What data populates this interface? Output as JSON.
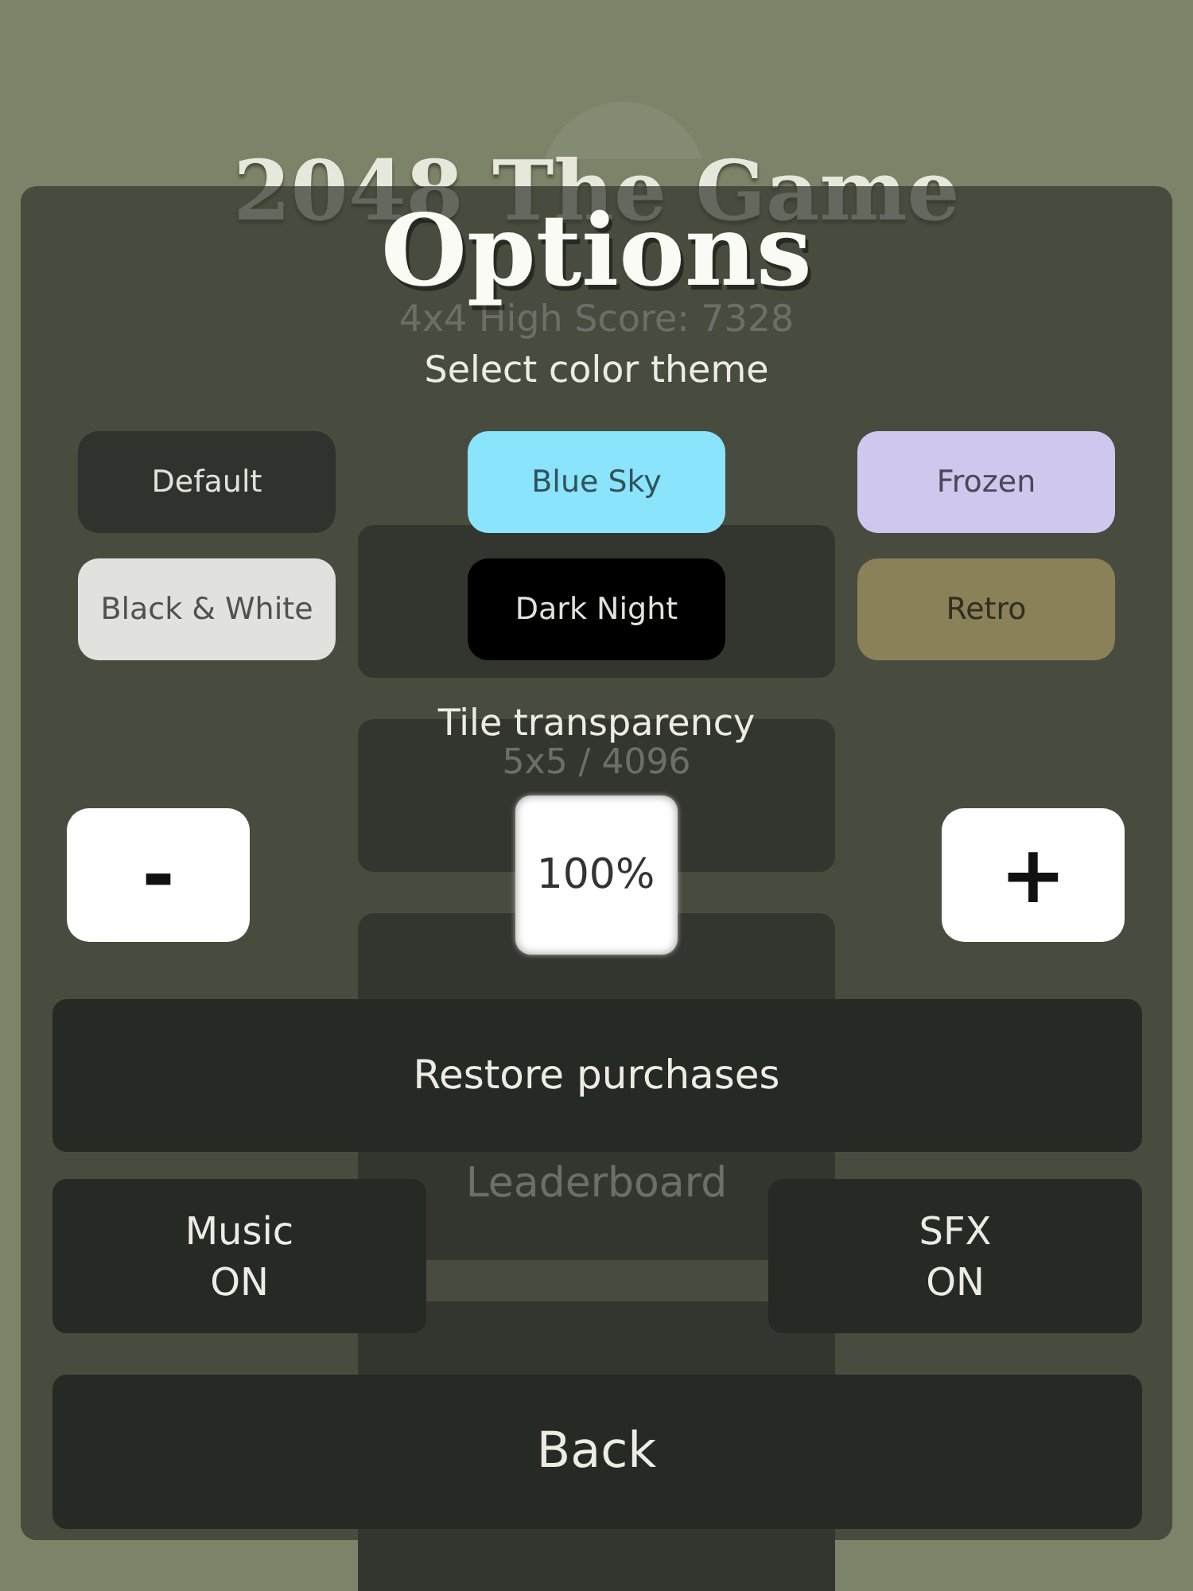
{
  "background_menu": {
    "title": "2048 The Game",
    "high_score": "4x4 High Score: 7328",
    "buttons": [
      {
        "kind": "mode"
      },
      {
        "kind": "mode",
        "label": "5x5 / 4096"
      },
      {
        "kind": "menu"
      },
      {
        "kind": "menu",
        "label": "Leaderboard"
      },
      {
        "kind": "menu"
      },
      {
        "kind": "menu"
      }
    ]
  },
  "dialog": {
    "title": "Options",
    "theme_heading": "Select color theme",
    "themes": [
      {
        "label": "Default",
        "color": "#2f332d"
      },
      {
        "label": "Blue Sky",
        "color": "#8ae4fc"
      },
      {
        "label": "Frozen",
        "color": "#cfc7ee"
      },
      {
        "label": "Black & White",
        "color": "#e1e1de"
      },
      {
        "label": "Dark Night",
        "color": "#000000"
      },
      {
        "label": "Retro",
        "color": "#8a8159"
      }
    ],
    "transparency_heading": "Tile transparency",
    "transparency": {
      "decrease": "-",
      "value": "100%",
      "increase": "+"
    },
    "restore_button": "Restore purchases",
    "toggles": [
      {
        "label": "Music",
        "value": "ON"
      },
      {
        "label": "SFX",
        "value": "ON"
      }
    ],
    "back_button": "Back"
  }
}
